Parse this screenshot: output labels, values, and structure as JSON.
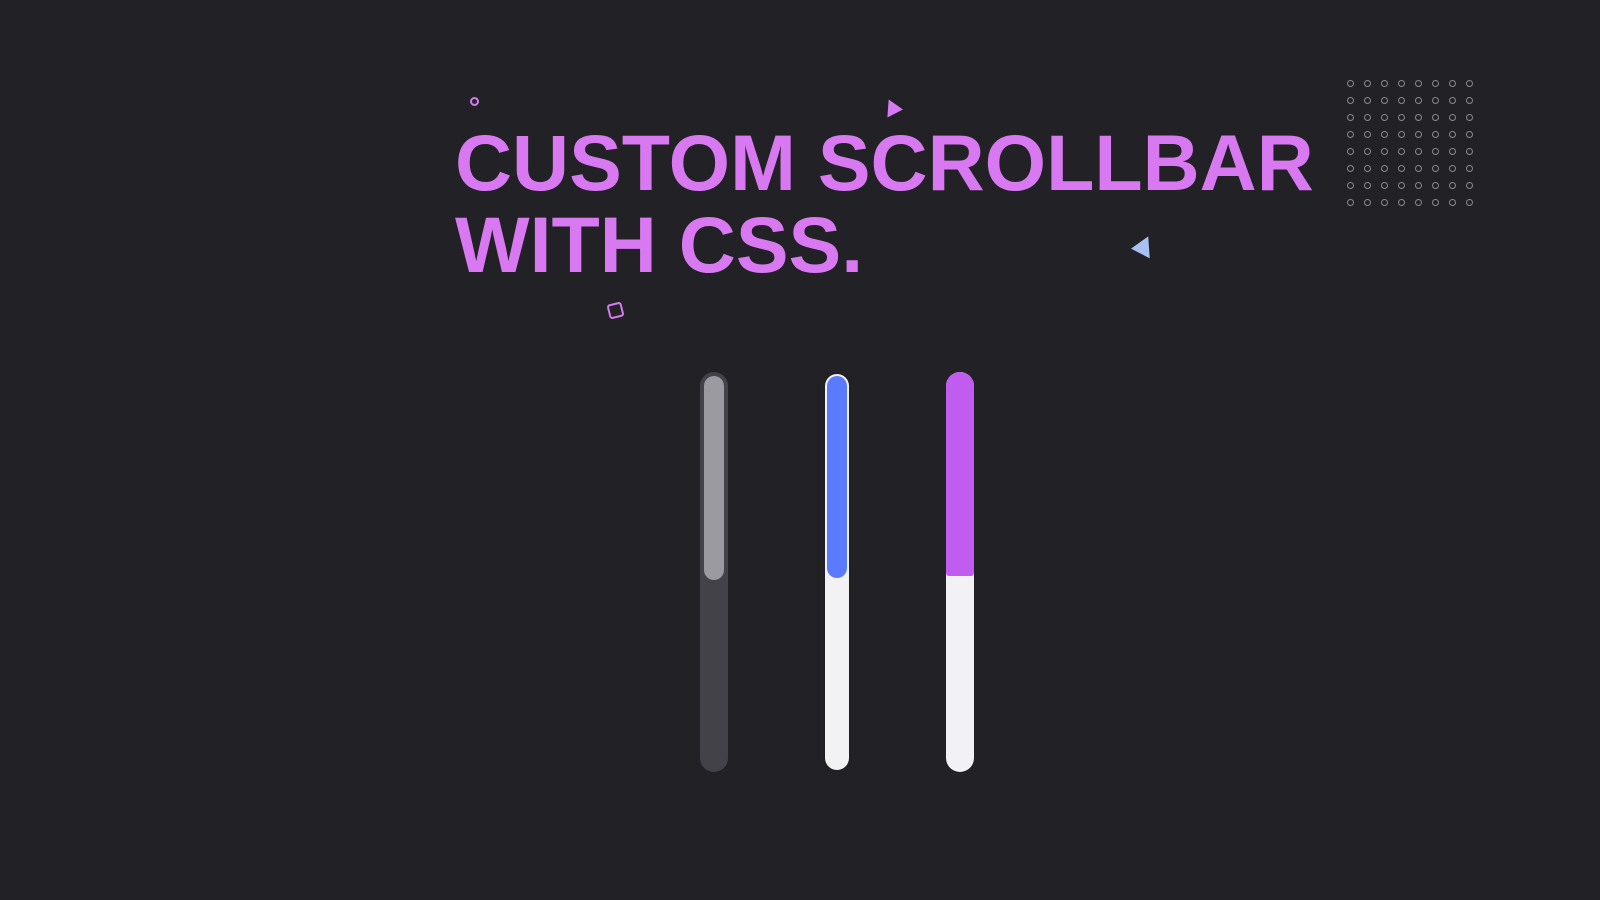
{
  "headline": {
    "line1": "CUSTOM SCROLLBAR",
    "line2": "WITH CSS."
  },
  "colors": {
    "background": "#222226",
    "accent_purple": "#d979f2",
    "accent_blue": "#5a7bff",
    "accent_lilac": "#c15cf0",
    "track_dark": "#424248",
    "track_light": "#f2f2f4",
    "thumb_grey": "#9a9aa0",
    "deco_blue": "#a9c0f0"
  },
  "scrollbars": [
    {
      "id": "scrollbar-grey",
      "track": "#424248",
      "thumb": "#9a9aa0",
      "fill_percent": 51
    },
    {
      "id": "scrollbar-blue",
      "track": "#f2f2f4",
      "thumb": "#5a7bff",
      "fill_percent": 51
    },
    {
      "id": "scrollbar-purple",
      "track": "#f2f2f4",
      "thumb": "#c15cf0",
      "fill_percent": 51
    }
  ],
  "dot_grid": {
    "rows": 8,
    "cols": 8
  }
}
